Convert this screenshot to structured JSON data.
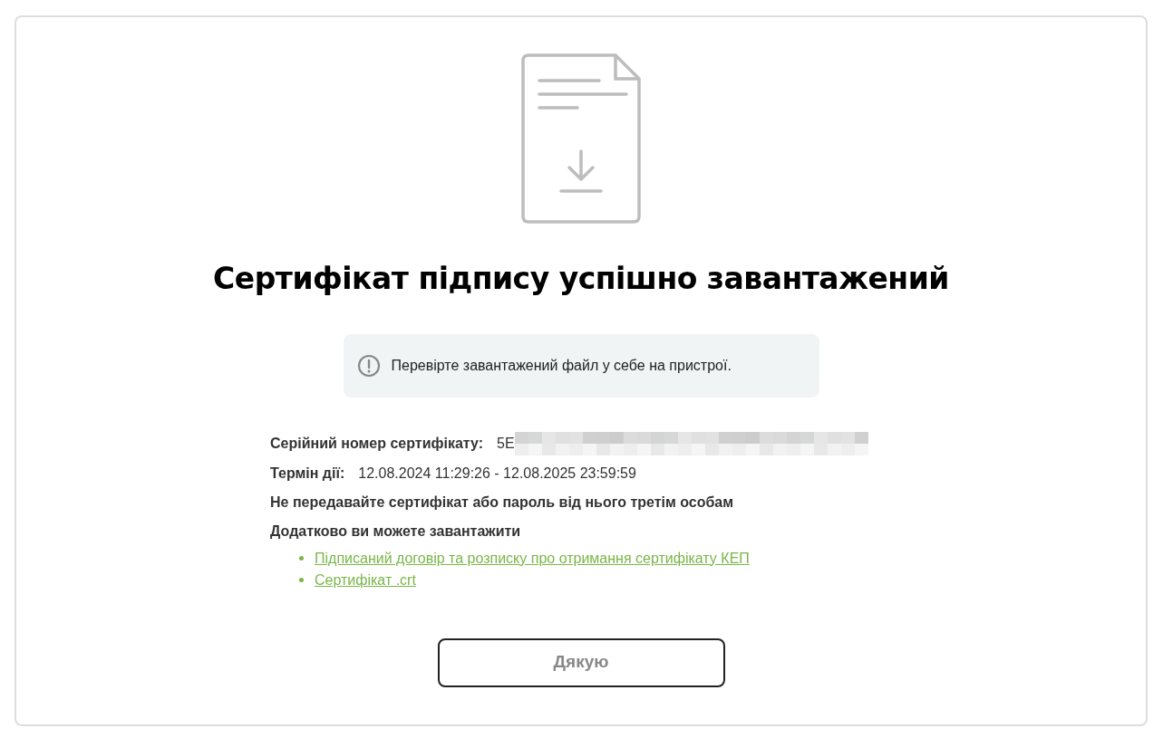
{
  "title": "Сертифікат підпису успішно завантажений",
  "notice": "Перевірте завантажений файл у себе на пристрої.",
  "details": [
    {
      "kind": "serial",
      "label": "Серійний номер сертифікату:",
      "value": "5E"
    },
    {
      "kind": "validity",
      "label": "Термін дії:",
      "value": "12.08.2024 11:29:26 - 12.08.2025 23:59:59"
    }
  ],
  "warning": "Не передавайте сертифікат або пароль від нього третім особам",
  "downloads": {
    "heading": "Додатково ви можете завантажити",
    "links": [
      "Підписаний договір та розписку про отримання сертифікату КЕП",
      "Сертифікат .crt"
    ]
  },
  "button": "Дякую"
}
